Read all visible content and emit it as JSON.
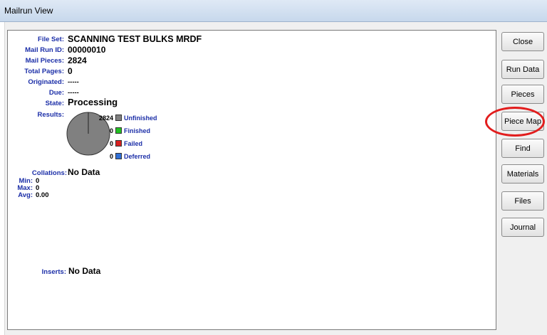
{
  "window": {
    "title": "Mailrun View"
  },
  "details": {
    "file_set": {
      "label": "File Set:",
      "value": "SCANNING TEST BULKS MRDF"
    },
    "mail_run_id": {
      "label": "Mail Run ID:",
      "value": "00000010"
    },
    "mail_pieces": {
      "label": "Mail Pieces:",
      "value": "2824"
    },
    "total_pages": {
      "label": "Total Pages:",
      "value": "0"
    },
    "originated": {
      "label": "Originated:",
      "value": "-----"
    },
    "due": {
      "label": "Due:",
      "value": "-----"
    },
    "state": {
      "label": "State:",
      "value": "Processing"
    }
  },
  "results": {
    "label": "Results:",
    "items": [
      {
        "count": "2824",
        "label": "Unfinished",
        "color": "#808080"
      },
      {
        "count": "0",
        "label": "Finished",
        "color": "#22c122"
      },
      {
        "count": "0",
        "label": "Failed",
        "color": "#d92020"
      },
      {
        "count": "0",
        "label": "Deferred",
        "color": "#2f6fd6"
      }
    ]
  },
  "collations": {
    "label": "Collations:",
    "value": "No Data",
    "min": {
      "label": "Min:",
      "value": "0"
    },
    "max": {
      "label": "Max:",
      "value": "0"
    },
    "avg": {
      "label": "Avg:",
      "value": "0.00"
    }
  },
  "inserts": {
    "label": "Inserts:",
    "value": "No Data"
  },
  "buttons": {
    "close": "Close",
    "run_data": "Run Data",
    "pieces": "Pieces",
    "piece_map": "Piece Map",
    "find": "Find",
    "materials": "Materials",
    "files": "Files",
    "journal": "Journal"
  },
  "colors": {
    "label_blue": "#1c2fa8",
    "highlight_red": "#e21d1d"
  }
}
